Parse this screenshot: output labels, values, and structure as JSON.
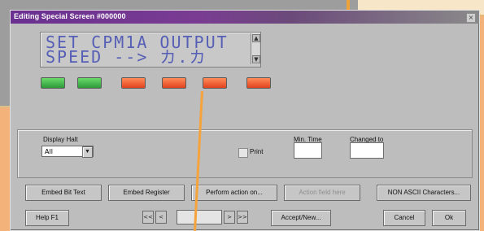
{
  "window": {
    "title": "Editing Special Screen #000000",
    "close_symbol": "×"
  },
  "lcd": {
    "line1": "SET CPM1A OUTPUT",
    "line2": "SPEED --> カ.カ"
  },
  "indicators": [
    {
      "state": "on",
      "color": "#2e9a3a"
    },
    {
      "state": "on",
      "color": "#2e9a3a"
    },
    {
      "state": "off",
      "color": "#e2431d"
    },
    {
      "state": "off",
      "color": "#e2431d"
    },
    {
      "state": "off",
      "color": "#e2431d"
    },
    {
      "state": "off",
      "color": "#e2431d"
    }
  ],
  "settings": {
    "display_halt_label": "Display Halt",
    "display_halt_value": "All",
    "print_label": "Print",
    "min_time_label": "Min. Time",
    "changed_to_label": "Changed to",
    "min_time_value": "",
    "changed_to_value": ""
  },
  "buttons": {
    "embed_bit_text": "Embed Bit Text",
    "embed_register": "Embed Register",
    "perform_action": "Perform action on...",
    "action_field_here": "Action field here",
    "non_ascii": "NON ASCII Characters...",
    "help": "Help F1",
    "accept_new": "Accept/New...",
    "cancel": "Cancel",
    "ok": "Ok"
  },
  "pager": {
    "first": "<<",
    "prev": "<",
    "next": ">",
    "last": ">>"
  }
}
